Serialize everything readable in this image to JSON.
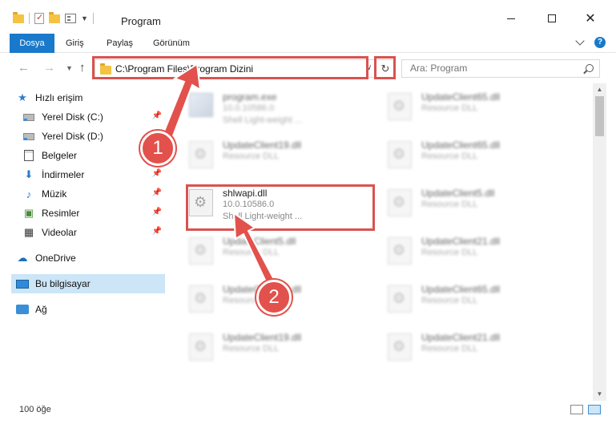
{
  "window": {
    "title": "Program"
  },
  "ribbon": {
    "tabs": [
      "Dosya",
      "Giriş",
      "Paylaş",
      "Görünüm"
    ]
  },
  "address": {
    "path": "C:\\Program Files\\Program Dizini"
  },
  "search": {
    "placeholder": "Ara: Program"
  },
  "sidebar": {
    "items": [
      {
        "label": "Hızlı erişim"
      },
      {
        "label": "Yerel Disk (C:)"
      },
      {
        "label": "Yerel Disk (D:)"
      },
      {
        "label": "Belgeler"
      },
      {
        "label": "İndirmeler"
      },
      {
        "label": "Müzik"
      },
      {
        "label": "Resimler"
      },
      {
        "label": "Videolar"
      },
      {
        "label": "OneDrive"
      },
      {
        "label": "Bu bilgisayar"
      },
      {
        "label": "Ağ"
      }
    ]
  },
  "files": [
    {
      "name": "program.exe",
      "version": "10.0.10586.0",
      "desc": "Shell Light-weight ..."
    },
    {
      "name": "UpdateClient65.dll",
      "desc": "Resource DLL"
    },
    {
      "name": "UpdateClient19.dll",
      "desc": "Resource DLL"
    },
    {
      "name": "UpdateClient65.dll",
      "desc": "Resource DLL"
    },
    {
      "name": "shlwapi.dll",
      "version": "10.0.10586.0",
      "desc": "Shell Light-weight ..."
    },
    {
      "name": "UpdateClient5.dll",
      "desc": "Resource DLL"
    },
    {
      "name": "UpdateClient5.dll",
      "desc": "Resource DLL"
    },
    {
      "name": "UpdateClient21.dll",
      "desc": "Resource DLL"
    },
    {
      "name": "UpdateClient65.dll",
      "desc": "Resource DLL"
    },
    {
      "name": "UpdateClient65.dll",
      "desc": "Resource DLL"
    },
    {
      "name": "UpdateClient19.dll",
      "desc": "Resource DLL"
    },
    {
      "name": "UpdateClient21.dll",
      "desc": "Resource DLL"
    }
  ],
  "status": {
    "count": "100 öğe"
  },
  "annotations": {
    "step1": "1",
    "step2": "2",
    "color": "#e2514c"
  }
}
